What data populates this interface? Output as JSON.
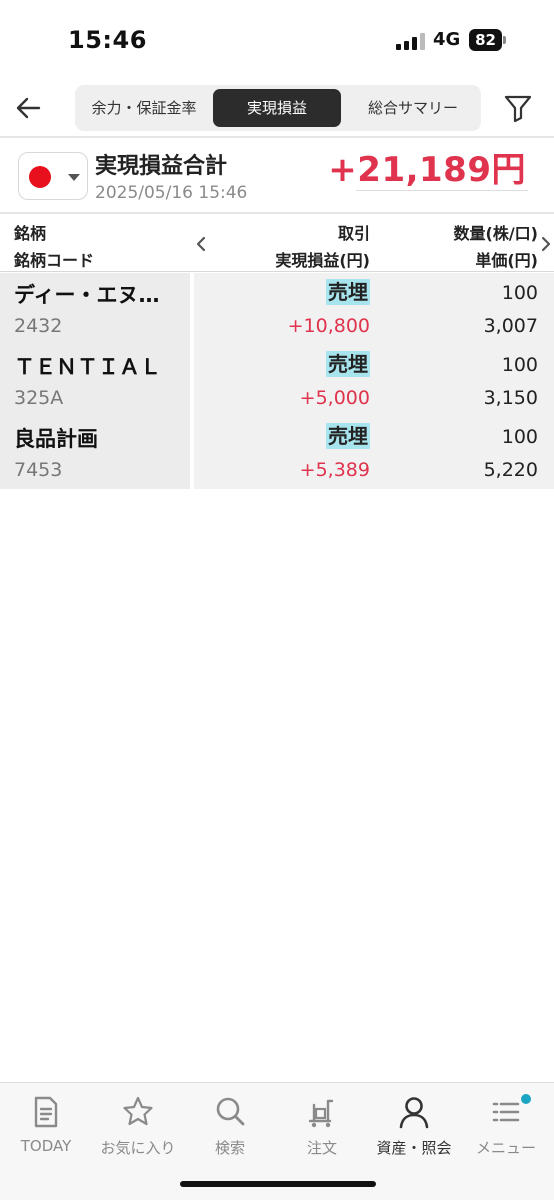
{
  "status_bar": {
    "time": "15:46",
    "network": "4G",
    "battery": "82"
  },
  "header": {
    "tabs": [
      {
        "label": "余力・保証金率"
      },
      {
        "label": "実現損益"
      },
      {
        "label": "総合サマリー"
      }
    ],
    "active_tab": "実現損益"
  },
  "summary": {
    "title": "実現損益合計",
    "datetime": "2025/05/16 15:46",
    "total": "+21,189円",
    "market_flag": "japan-flag-icon"
  },
  "columns": {
    "name": "銘柄",
    "code": "銘柄コード",
    "trade": "取引",
    "pnl": "実現損益(円)",
    "qty": "数量(株/口)",
    "price": "単価(円)"
  },
  "rows": [
    {
      "name": "ディー・エヌ…",
      "code": "2432",
      "trade": "売埋",
      "pnl": "+10,800",
      "qty": "100",
      "price": "3,007"
    },
    {
      "name": "ＴＥＮＴＩＡＬ",
      "code": "325A",
      "trade": "売埋",
      "pnl": "+5,000",
      "qty": "100",
      "price": "3,150"
    },
    {
      "name": "良品計画",
      "code": "7453",
      "trade": "売埋",
      "pnl": "+5,389",
      "qty": "100",
      "price": "5,220"
    }
  ],
  "colors": {
    "positive": "#e0334d",
    "trade_highlight": "#a8e4ee",
    "accent_dot": "#1aa5c4"
  },
  "bottom_nav": [
    {
      "label": "TODAY",
      "icon": "document-icon"
    },
    {
      "label": "お気に入り",
      "icon": "star-icon"
    },
    {
      "label": "検索",
      "icon": "search-icon"
    },
    {
      "label": "注文",
      "icon": "cart-icon"
    },
    {
      "label": "資産・照会",
      "icon": "person-icon",
      "active": true
    },
    {
      "label": "メニュー",
      "icon": "menu-icon"
    }
  ]
}
